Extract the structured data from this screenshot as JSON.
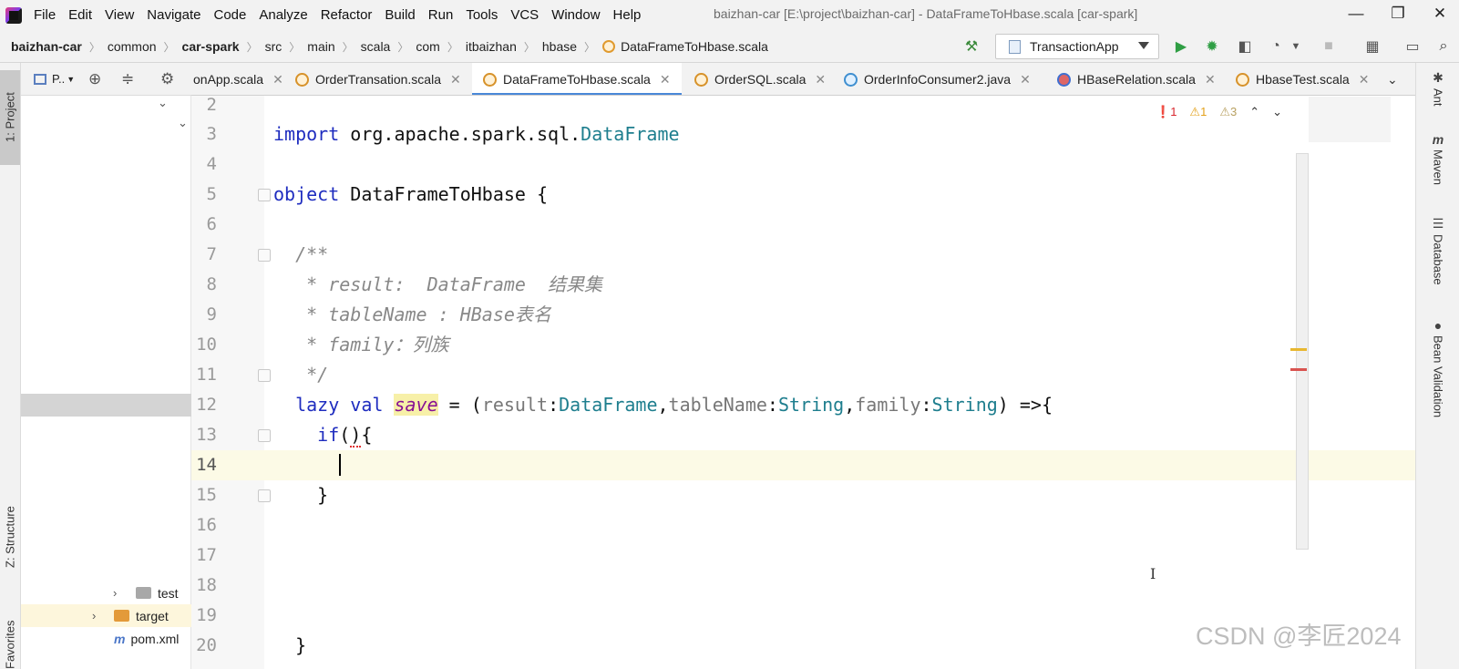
{
  "menubar": {
    "items": [
      "File",
      "Edit",
      "View",
      "Navigate",
      "Code",
      "Analyze",
      "Refactor",
      "Build",
      "Run",
      "Tools",
      "VCS",
      "Window",
      "Help"
    ],
    "window_title": "baizhan-car [E:\\project\\baizhan-car] - DataFrameToHbase.scala [car-spark]"
  },
  "breadcrumbs": [
    "baizhan-car",
    "common",
    "car-spark",
    "src",
    "main",
    "scala",
    "com",
    "itbaizhan",
    "hbase",
    "DataFrameToHbase.scala"
  ],
  "toolbar": {
    "run_config": "TransactionApp"
  },
  "left_stripe": {
    "project_tab": "1: Project",
    "structure_tab": "Z: Structure",
    "favorites_tab": "Favorites"
  },
  "project_panel": {
    "title": "P..",
    "tree": [
      {
        "label": "test"
      },
      {
        "label": "target"
      },
      {
        "label": "pom.xml"
      }
    ]
  },
  "tabs": [
    {
      "label": "onApp.scala",
      "kind": "scala"
    },
    {
      "label": "OrderTransation.scala",
      "kind": "scala"
    },
    {
      "label": "DataFrameToHbase.scala",
      "kind": "scala",
      "active": true
    },
    {
      "label": "OrderSQL.scala",
      "kind": "scala"
    },
    {
      "label": "OrderInfoConsumer2.java",
      "kind": "java"
    },
    {
      "label": "HBaseRelation.scala",
      "kind": "hbase"
    },
    {
      "label": "HbaseTest.scala",
      "kind": "scala"
    }
  ],
  "inspections": {
    "errors": "1",
    "warnings": "1",
    "weak_warnings": "3"
  },
  "editor": {
    "line_numbers": [
      "2",
      "3",
      "4",
      "5",
      "6",
      "7",
      "8",
      "9",
      "10",
      "11",
      "12",
      "13",
      "14",
      "15",
      "16",
      "17",
      "18",
      "19",
      "20"
    ],
    "current_line": "14"
  },
  "right_stripe": [
    "Ant",
    "Maven",
    "Database",
    "Bean Validation"
  ],
  "watermark": "CSDN @李匠2024"
}
